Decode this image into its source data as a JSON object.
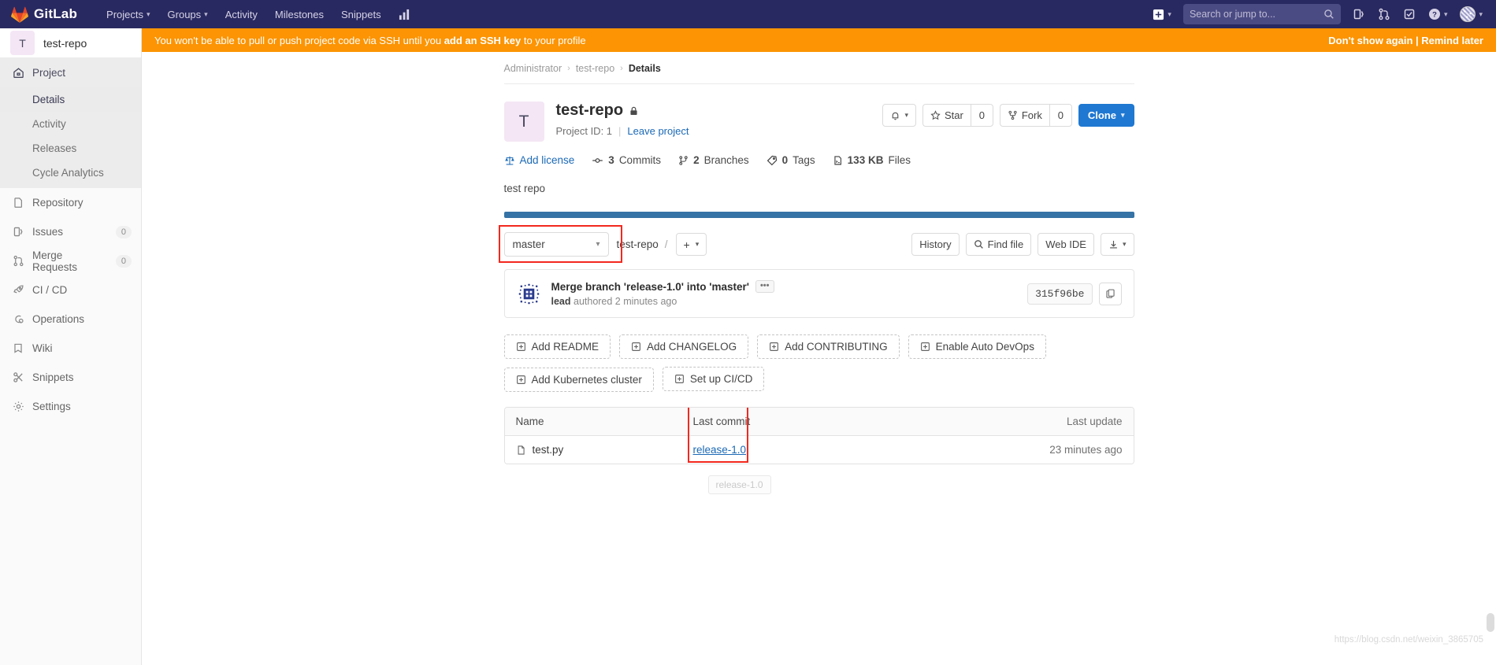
{
  "navbar": {
    "brand": "GitLab",
    "items": [
      {
        "label": "Projects",
        "has_caret": true
      },
      {
        "label": "Groups",
        "has_caret": true
      },
      {
        "label": "Activity",
        "has_caret": false
      },
      {
        "label": "Milestones",
        "has_caret": false
      },
      {
        "label": "Snippets",
        "has_caret": false
      }
    ],
    "chart_icon": "chart-icon",
    "plus_label": "+",
    "search_placeholder": "Search or jump to...",
    "right_icons": [
      "issues-icon",
      "merge-request-icon",
      "todos-icon",
      "help-icon",
      "user-avatar"
    ]
  },
  "alert": {
    "text_before": "You won't be able to pull or push project code via SSH until you ",
    "link": "add an SSH key",
    "text_after": " to your profile",
    "dismiss": "Don't show again | Remind later"
  },
  "sidebar": {
    "project_initial": "T",
    "project_name": "test-repo",
    "group_label": "Project",
    "sub_items": [
      {
        "label": "Details",
        "active": true
      },
      {
        "label": "Activity",
        "active": false
      },
      {
        "label": "Releases",
        "active": false
      },
      {
        "label": "Cycle Analytics",
        "active": false
      }
    ],
    "items": [
      {
        "label": "Repository",
        "icon": "document-icon",
        "badge": ""
      },
      {
        "label": "Issues",
        "icon": "issues-icon",
        "badge": "0"
      },
      {
        "label": "Merge Requests",
        "icon": "merge-request-icon",
        "badge": "0"
      },
      {
        "label": "CI / CD",
        "icon": "rocket-icon",
        "badge": ""
      },
      {
        "label": "Operations",
        "icon": "operations-icon",
        "badge": ""
      },
      {
        "label": "Wiki",
        "icon": "book-icon",
        "badge": ""
      },
      {
        "label": "Snippets",
        "icon": "snippet-icon",
        "badge": ""
      },
      {
        "label": "Settings",
        "icon": "gear-icon",
        "badge": ""
      }
    ]
  },
  "breadcrumb": [
    {
      "label": "Administrator"
    },
    {
      "label": "test-repo"
    },
    {
      "label": "Details"
    }
  ],
  "project": {
    "initial": "T",
    "name": "test-repo",
    "visibility_icon": "lock-icon",
    "project_id_label": "Project ID: 1",
    "leave_link": "Leave project",
    "description": "test repo"
  },
  "header_actions": {
    "notification_icon": "bell-icon",
    "star_label": "Star",
    "star_count": "0",
    "fork_label": "Fork",
    "fork_count": "0",
    "clone_label": "Clone"
  },
  "stats": [
    {
      "label": "Add license",
      "value": "",
      "icon": "scale-icon",
      "is_link": true
    },
    {
      "label": "Commits",
      "value": "3",
      "icon": "commit-icon",
      "is_link": false
    },
    {
      "label": "Branches",
      "value": "2",
      "icon": "branch-icon",
      "is_link": false
    },
    {
      "label": "Tags",
      "value": "0",
      "icon": "tag-icon",
      "is_link": false
    },
    {
      "label": "Files",
      "value": "133 KB",
      "icon": "file-icon",
      "is_link": false
    }
  ],
  "toolbar": {
    "branch": "master",
    "path_root": "test-repo",
    "path_sep": "/",
    "add_label": "+",
    "history_label": "History",
    "find_file_label": "Find file",
    "web_ide_label": "Web IDE",
    "download_icon": "download-icon"
  },
  "commit": {
    "message": "Merge branch 'release-1.0' into 'master'",
    "more": "•••",
    "author": "lead",
    "meta": " authored 2 minutes ago",
    "sha": "315f96be",
    "copy_icon": "copy-icon"
  },
  "quick_actions": [
    {
      "label": "Add README"
    },
    {
      "label": "Add CHANGELOG"
    },
    {
      "label": "Add CONTRIBUTING"
    },
    {
      "label": "Enable Auto DevOps"
    },
    {
      "label": "Add Kubernetes cluster"
    },
    {
      "label": "Set up CI/CD"
    }
  ],
  "files": {
    "columns": {
      "name": "Name",
      "last_commit": "Last commit",
      "last_update": "Last update"
    },
    "rows": [
      {
        "name": "test.py",
        "icon": "file-icon",
        "last_commit": "release-1.0",
        "last_update": "23 minutes ago"
      }
    ],
    "tooltip": "release-1.0"
  },
  "watermark": "https://blog.csdn.net/weixin_3865705",
  "colors": {
    "nav_bg": "#292961",
    "alert_bg": "#fc9403",
    "primary": "#1f78d1",
    "link": "#1b69b6",
    "annotation": "#f3281e",
    "lang_bar": "#3572a5"
  }
}
